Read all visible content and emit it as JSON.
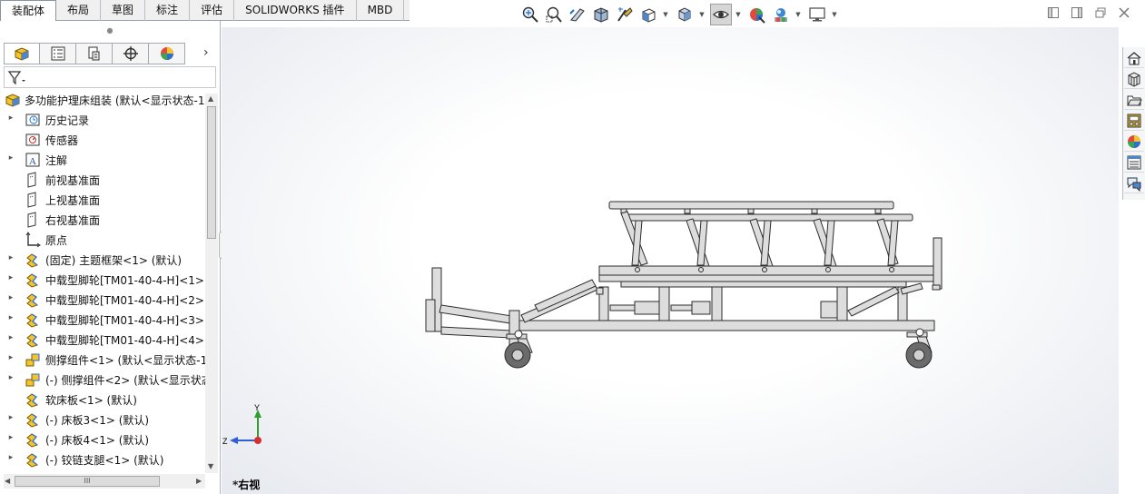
{
  "tabs": [
    {
      "label": "装配体",
      "active": true
    },
    {
      "label": "布局",
      "active": false
    },
    {
      "label": "草图",
      "active": false
    },
    {
      "label": "标注",
      "active": false
    },
    {
      "label": "评估",
      "active": false
    },
    {
      "label": "SOLIDWORKS 插件",
      "active": false
    },
    {
      "label": "MBD",
      "active": false
    }
  ],
  "toolbar": {
    "icons": [
      "zoom-to-fit-icon",
      "zoom-to-area-icon",
      "previous-view-icon",
      "section-view-icon",
      "dynamic-annotation-icon",
      "view-orientation-icon",
      "display-style-icon",
      "hide-show-icon",
      "edit-appearance-icon",
      "apply-scene-icon",
      "view-setting-icon"
    ]
  },
  "panel_tabs": [
    "featuremanager-tab",
    "propertymanager-tab",
    "configurationmanager-tab",
    "dimxpert-tab",
    "displaymanager-tab"
  ],
  "tree": {
    "root": "多功能护理床组装 (默认<显示状态-1",
    "items": [
      {
        "label": "历史记录",
        "icon": "history-icon",
        "expandable": true
      },
      {
        "label": "传感器",
        "icon": "sensor-icon",
        "expandable": false
      },
      {
        "label": "注解",
        "icon": "annotation-icon",
        "expandable": true
      },
      {
        "label": "前视基准面",
        "icon": "plane-icon",
        "expandable": false
      },
      {
        "label": "上视基准面",
        "icon": "plane-icon",
        "expandable": false
      },
      {
        "label": "右视基准面",
        "icon": "plane-icon",
        "expandable": false
      },
      {
        "label": "原点",
        "icon": "origin-icon",
        "expandable": false
      },
      {
        "label": "(固定) 主题框架<1> (默认)",
        "icon": "part-icon",
        "expandable": true
      },
      {
        "label": "中载型脚轮[TM01-40-4-H]<1>",
        "icon": "part-icon",
        "expandable": true
      },
      {
        "label": "中载型脚轮[TM01-40-4-H]<2>",
        "icon": "part-icon",
        "expandable": true
      },
      {
        "label": "中载型脚轮[TM01-40-4-H]<3>",
        "icon": "part-icon",
        "expandable": true
      },
      {
        "label": "中载型脚轮[TM01-40-4-H]<4>",
        "icon": "part-icon",
        "expandable": true
      },
      {
        "label": "侧撑组件<1> (默认<显示状态-1",
        "icon": "subassembly-icon",
        "expandable": true
      },
      {
        "label": "(-) 侧撑组件<2> (默认<显示状态",
        "icon": "subassembly-icon",
        "expandable": true
      },
      {
        "label": "软床板<1> (默认)",
        "icon": "part-icon",
        "expandable": false
      },
      {
        "label": "(-) 床板3<1> (默认)",
        "icon": "part-icon",
        "expandable": true
      },
      {
        "label": "(-) 床板4<1> (默认)",
        "icon": "part-icon",
        "expandable": true
      },
      {
        "label": "(-) 铰链支腿<1> (默认)",
        "icon": "part-icon",
        "expandable": true
      }
    ]
  },
  "viewport": {
    "view_name": "*右视",
    "triad": {
      "y_label": "Y",
      "z_label": "Z"
    }
  },
  "task_pane": [
    "solidworks-resources-icon",
    "design-library-icon",
    "file-explorer-icon",
    "view-palette-icon",
    "appearances-icon",
    "custom-properties-icon",
    "forum-icon"
  ],
  "colors": {
    "accent": "#1a6fd1",
    "frame": "#dcdcdc",
    "stroke": "#303030"
  }
}
